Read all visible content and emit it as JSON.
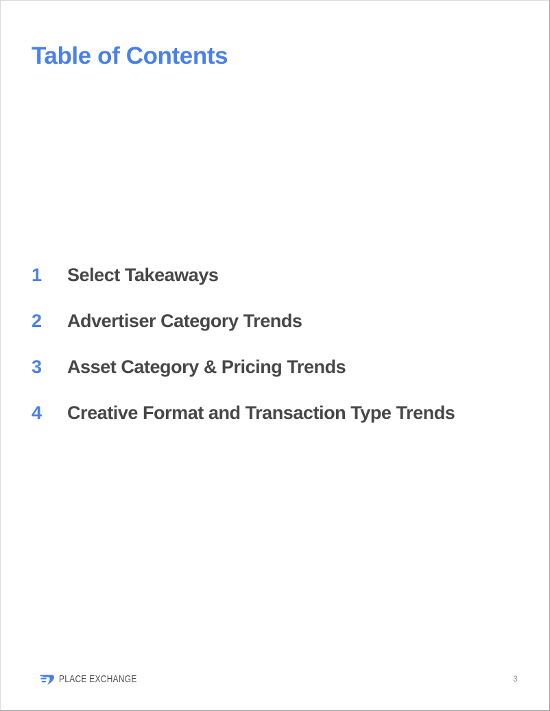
{
  "page": {
    "title": "Table of Contents",
    "title_color": "#4a80ea",
    "background_color": "#ffffff",
    "number": "3"
  },
  "toc": {
    "items": [
      {
        "number": "1",
        "label": "Select Takeaways"
      },
      {
        "number": "2",
        "label": "Advertiser Category Trends"
      },
      {
        "number": "3",
        "label": "Asset Category & Pricing Trends"
      },
      {
        "number": "4",
        "label": "Creative Format and Transaction Type Trends"
      }
    ],
    "number_color": "#4a80ea",
    "label_color": "#474747"
  },
  "footer": {
    "brand_name": "PLACE EXCHANGE",
    "brand_mark_icon": "place-exchange-swoosh-icon",
    "brand_mark_color": "#4a80ea",
    "brand_text_color": "#4a4a4a",
    "page_number": "3"
  }
}
